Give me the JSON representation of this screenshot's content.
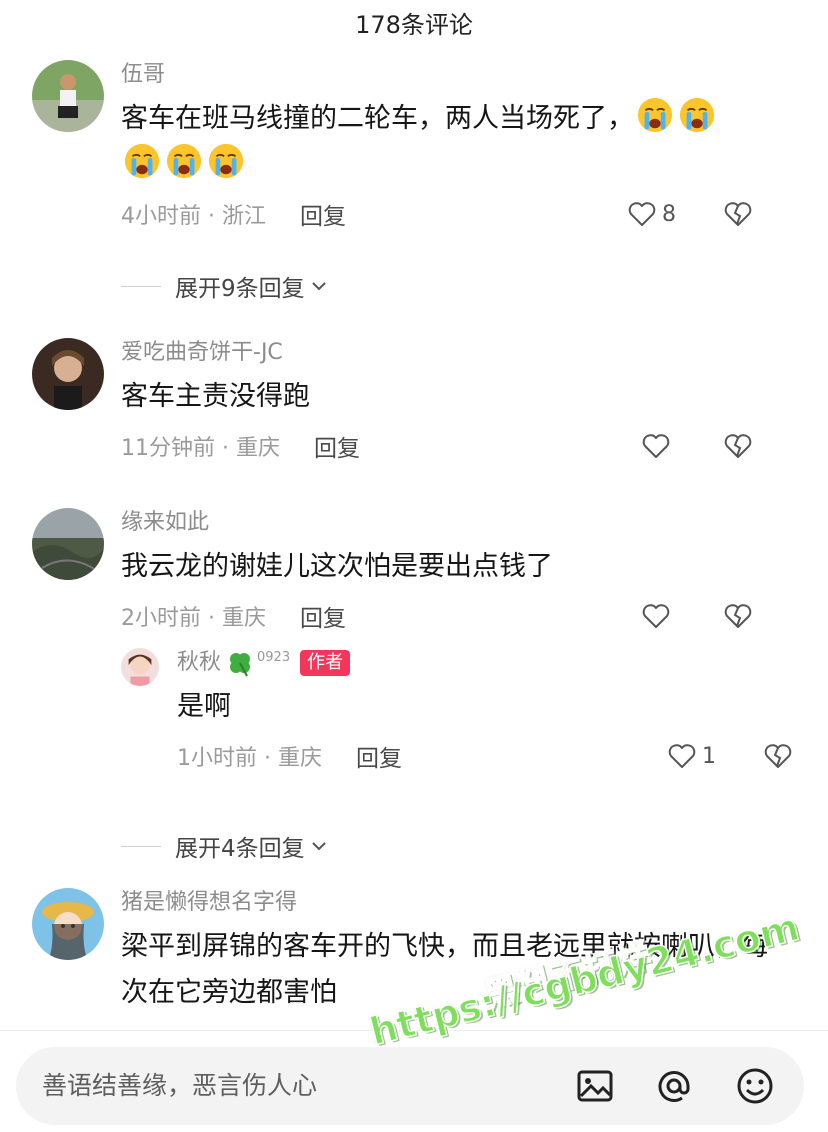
{
  "header": {
    "title": "178条评论"
  },
  "comments": [
    {
      "username": "伍哥",
      "text": "客车在班马线撞的二轮车，两人当场死了，",
      "emoji_icon": "crying-face-icon",
      "emoji_count": 5,
      "time_location": "4小时前 · 浙江",
      "reply_label": "回复",
      "likes": "8",
      "expand_label": "展开9条回复"
    },
    {
      "username": "爱吃曲奇饼干-JC",
      "text": "客车主责没得跑",
      "time_location": "11分钟前 · 重庆",
      "reply_label": "回复",
      "likes": ""
    },
    {
      "username": "缘来如此",
      "text": "我云龙的谢娃儿这次怕是要出点钱了",
      "time_location": "2小时前 · 重庆",
      "reply_label": "回复",
      "likes": "",
      "sub_reply": {
        "username": "秋秋",
        "badge_icon": "four-leaf-clover-icon",
        "badge_number": "0923",
        "author_tag": "作者",
        "text": "是啊",
        "time_location": "1小时前 · 重庆",
        "reply_label": "回复",
        "likes": "1"
      },
      "expand_label": "展开4条回复"
    },
    {
      "username": "猪是懒得想名字得",
      "text": "梁平到屏锦的客车开的飞快，而且老远里就按喇叭，每次在它旁边都害怕"
    }
  ],
  "input": {
    "placeholder": "善语结善缘，恶言伤人心",
    "icons": [
      "image-icon",
      "at-icon",
      "emoji-icon"
    ]
  },
  "watermark": {
    "line1": "黑料不打烊",
    "line2": "https://cgbdy24.com"
  },
  "colors": {
    "author_tag": "#f5365c",
    "watermark": "#7ee05a"
  }
}
